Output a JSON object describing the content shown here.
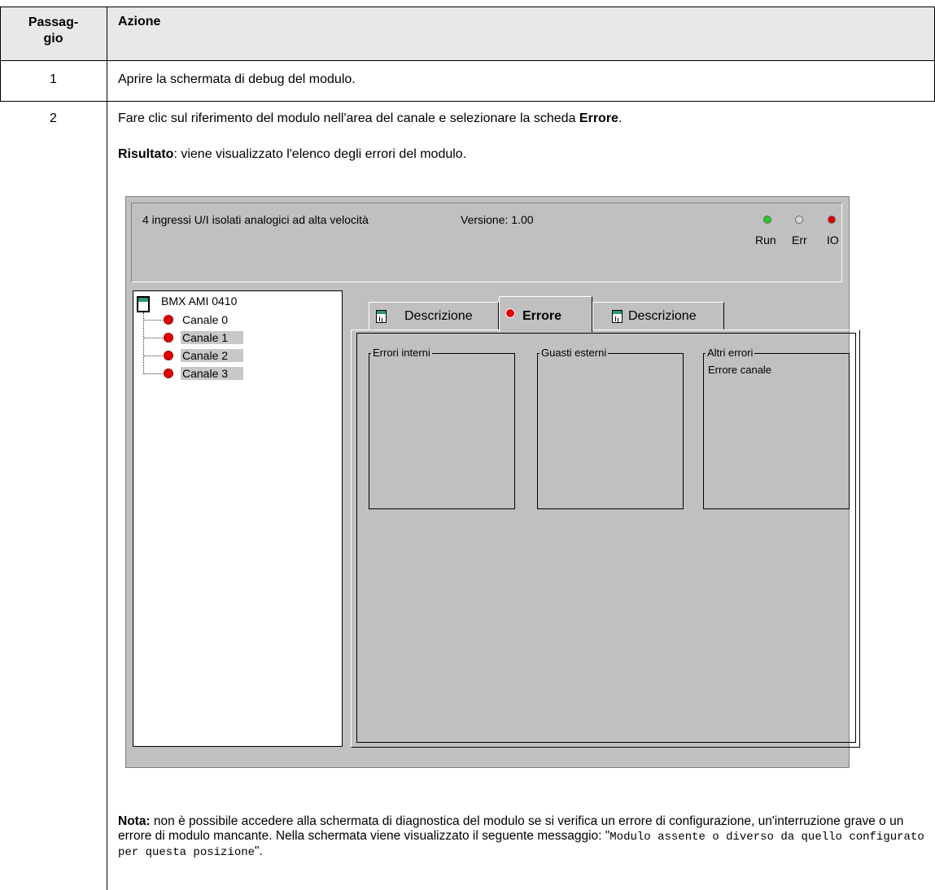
{
  "table": {
    "col_step": "Passag-\ngio",
    "col_action": "Azione",
    "rows": [
      {
        "step": "1",
        "action": "Aprire la schermata di debug del modulo."
      },
      {
        "step": "2"
      }
    ],
    "row2": {
      "line1_pre": "Fare clic sul riferimento del modulo nell'area del canale e selezionare la scheda ",
      "line1_bold": "Errore",
      "line1_post": ".",
      "result_bold": "Risultato",
      "result_text": ": viene visualizzato l'elenco degli errori del modulo.",
      "note_bold": "Nota:",
      "note_text": " non è possibile accedere alla schermata di diagnostica del modulo se si verifica un errore di configurazione, un'interruzione grave o un errore di modulo mancante. Nella schermata viene visualizzato il seguente messaggio: \"",
      "note_mono": "Modulo assente o diverso da quello configurato per questa posizione",
      "note_end": "\"."
    }
  },
  "screen": {
    "module_title": "4 ingressi U/I isolati analogici ad alta velocità",
    "version": "Versione: 1.00",
    "leds": [
      {
        "label": "Run",
        "color": "#22cc22"
      },
      {
        "label": "Err",
        "color": "#d8d8d8"
      },
      {
        "label": "IO",
        "color": "#e00000"
      }
    ],
    "tree": {
      "root": "BMX AMI 0410",
      "channels": [
        "Canale 0",
        "Canale 1",
        "Canale 2",
        "Canale 3"
      ]
    },
    "tabs": [
      "Descrizione",
      "Errore",
      "Descrizione"
    ],
    "groups": {
      "internal": "Errori interni",
      "external": "Guasti esterni",
      "other": "Altri errori",
      "other_item": "Errore canale"
    }
  }
}
